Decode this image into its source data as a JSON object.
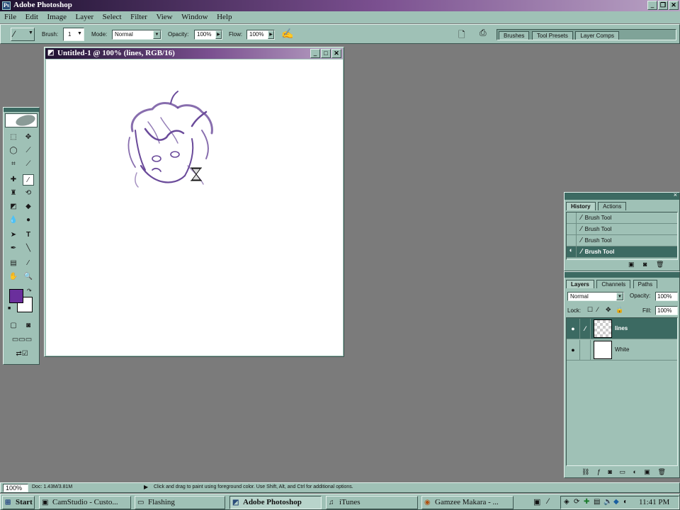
{
  "app": {
    "title": "Adobe Photoshop",
    "menu": [
      "File",
      "Edit",
      "Image",
      "Layer",
      "Select",
      "Filter",
      "View",
      "Window",
      "Help"
    ]
  },
  "options_bar": {
    "brush_label": "Brush:",
    "brush_size": "1",
    "mode_label": "Mode:",
    "mode_value": "Normal",
    "opacity_label": "Opacity:",
    "opacity_value": "100%",
    "flow_label": "Flow:",
    "flow_value": "100%"
  },
  "palette_well": {
    "tabs": [
      "Brushes",
      "Tool Presets",
      "Layer Comps"
    ]
  },
  "document": {
    "title": "Untitled-1 @ 100% (lines, RGB/16)"
  },
  "toolbox": {
    "foreground_color": "#6a2f9c",
    "background_color": "#ffffff"
  },
  "history_panel": {
    "tabs": [
      "History",
      "Actions"
    ],
    "items": [
      "Brush Tool",
      "Brush Tool",
      "Brush Tool",
      "Brush Tool"
    ]
  },
  "layers_panel": {
    "tabs": [
      "Layers",
      "Channels",
      "Paths"
    ],
    "blend_mode": "Normal",
    "opacity_label": "Opacity:",
    "opacity_value": "100%",
    "lock_label": "Lock:",
    "fill_label": "Fill:",
    "fill_value": "100%",
    "layers": [
      {
        "name": "lines",
        "selected": true
      },
      {
        "name": "White",
        "selected": false
      }
    ]
  },
  "status_bar": {
    "zoom": "100%",
    "doc_info": "Doc: 1.43M/3.81M",
    "hint": "Click and drag to paint using foreground color. Use Shift, Alt, and Ctrl for additional options."
  },
  "taskbar": {
    "start_label": "Start",
    "buttons": [
      "CamStudio - Custo...",
      "Flashing",
      "Adobe Photoshop",
      "iTunes",
      "Gamzee Makara - ..."
    ],
    "clock": "11:41 PM"
  }
}
